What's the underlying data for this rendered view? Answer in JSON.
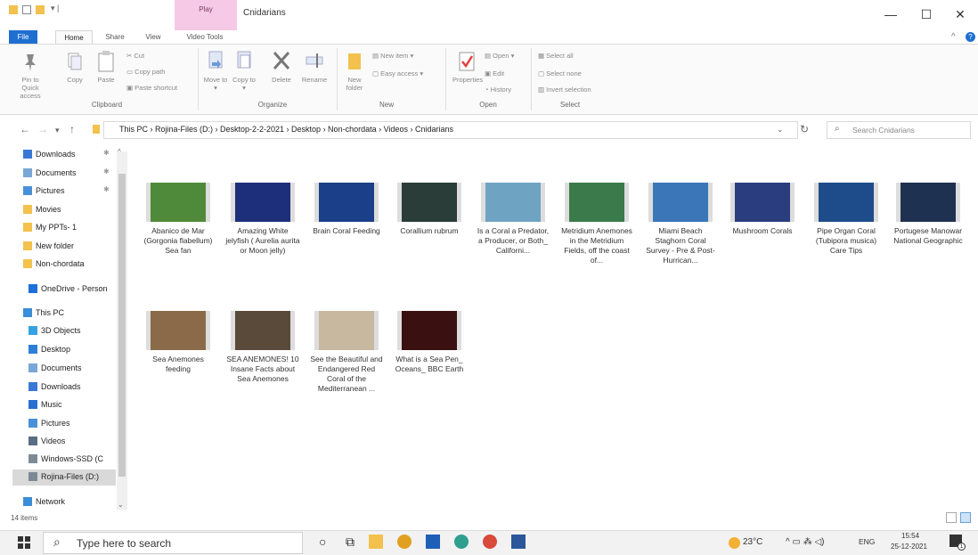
{
  "window": {
    "title": "Cnidarians",
    "context_tab": "Play",
    "controls": [
      "—",
      "☐",
      "✕"
    ]
  },
  "tabs": [
    "File",
    "Home",
    "Share",
    "View",
    "Video Tools"
  ],
  "ribbon": {
    "clipboard": {
      "pin": "Pin to Quick access",
      "copy": "Copy",
      "paste": "Paste",
      "cut": "Cut",
      "copy_path": "Copy path",
      "paste_shortcut": "Paste shortcut",
      "label": "Clipboard"
    },
    "organize": {
      "move_to": "Move to ▾",
      "copy_to": "Copy to ▾",
      "delete": "Delete",
      "rename": "Rename",
      "label": "Organize"
    },
    "new": {
      "new_folder": "New folder",
      "new_item": "New item ▾",
      "easy_access": "Easy access ▾",
      "label": "New"
    },
    "open": {
      "properties": "Properties",
      "open": "Open ▾",
      "edit": "Edit",
      "history": "History",
      "label": "Open"
    },
    "select": {
      "select_all": "Select all",
      "select_none": "Select none",
      "invert": "Invert selection",
      "label": "Select"
    }
  },
  "address": {
    "crumbs": "This PC  ›  Rojina-Files (D:)  ›  Desktop-2-2-2021  ›  Desktop  ›  Non-chordata  ›  Videos  ›  Cnidarians",
    "search_placeholder": "Search Cnidarians"
  },
  "sidebar": {
    "items": [
      {
        "label": "Downloads",
        "icon": "download-icon",
        "color": "#3a78d6"
      },
      {
        "label": "Documents",
        "icon": "document-icon",
        "color": "#7aa7d6"
      },
      {
        "label": "Pictures",
        "icon": "pictures-icon",
        "color": "#4a90d9"
      },
      {
        "label": "Movies",
        "icon": "folder-icon",
        "color": "#f2c14e"
      },
      {
        "label": "My PPTs- 1",
        "icon": "folder-icon",
        "color": "#f2c14e"
      },
      {
        "label": "New folder",
        "icon": "folder-icon",
        "color": "#f2c14e"
      },
      {
        "label": "Non-chordata",
        "icon": "folder-icon",
        "color": "#f2c14e"
      },
      {
        "label": "OneDrive - Person",
        "icon": "cloud-icon",
        "color": "#1e6fd9"
      },
      {
        "label": "This PC",
        "icon": "computer-icon",
        "color": "#3b8ed8"
      },
      {
        "label": "3D Objects",
        "icon": "cube-icon",
        "color": "#36a3e0"
      },
      {
        "label": "Desktop",
        "icon": "desktop-icon",
        "color": "#2d7fd6"
      },
      {
        "label": "Documents",
        "icon": "document-icon",
        "color": "#7aa7d6"
      },
      {
        "label": "Downloads",
        "icon": "download-icon",
        "color": "#3a78d6"
      },
      {
        "label": "Music",
        "icon": "music-icon",
        "color": "#2a6fd0"
      },
      {
        "label": "Pictures",
        "icon": "pictures-icon",
        "color": "#4a90d9"
      },
      {
        "label": "Videos",
        "icon": "video-icon",
        "color": "#5a6d84"
      },
      {
        "label": "Windows-SSD (C",
        "icon": "drive-icon",
        "color": "#7d8a96"
      },
      {
        "label": "Rojina-Files (D:)",
        "icon": "drive-icon",
        "color": "#7d8a96"
      },
      {
        "label": "Network",
        "icon": "network-icon",
        "color": "#3b8ed8"
      }
    ]
  },
  "files": [
    {
      "name": "Abanico de Mar (Gorgonia flabellum) Sea fan",
      "color": "#4f8a3a"
    },
    {
      "name": "Amazing White jelyfish ( Aurelia aurita or Moon jelly)",
      "color": "#1d2f7a"
    },
    {
      "name": "Brain Coral Feeding",
      "color": "#1b3f88"
    },
    {
      "name": "Corallium rubrum",
      "color": "#2b3d38"
    },
    {
      "name": "Is a Coral a Predator, a Producer, or Both_ Californi...",
      "color": "#6fa3c2"
    },
    {
      "name": "Metridium Anemones in the Metridium Fields, off the coast of...",
      "color": "#3b7a4b"
    },
    {
      "name": "Miami Beach Staghorn Coral Survey - Pre & Post-Hurrican...",
      "color": "#3a76b8"
    },
    {
      "name": "Mushroom Corals",
      "color": "#2a3d7f"
    },
    {
      "name": "Pipe Organ Coral (Tubipora musica) Care Tips",
      "color": "#1e4c8a"
    },
    {
      "name": "Portugese Manowar National Geographic",
      "color": "#1e3150"
    },
    {
      "name": "Sea Anemones feeding",
      "color": "#8a6a48"
    },
    {
      "name": "SEA ANEMONES! 10 Insane Facts about Sea Anemones",
      "color": "#5a4a3a"
    },
    {
      "name": "See the Beautiful and Endangered Red Coral of the Mediterranean ...",
      "color": "#c8b8a0"
    },
    {
      "name": "What is a Sea Pen_ Oceans_ BBC Earth",
      "color": "#3a1010"
    }
  ],
  "status": {
    "count": "14 items"
  },
  "taskbar": {
    "search": "Type here to search",
    "weather": "23°C",
    "lang": "ENG",
    "time": "15:54",
    "date": "25-12-2021",
    "notif": "1"
  }
}
